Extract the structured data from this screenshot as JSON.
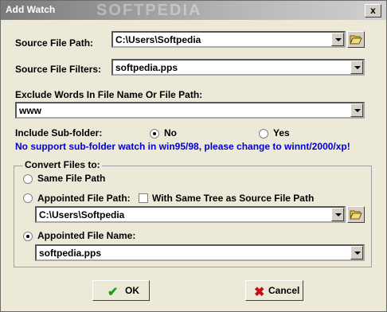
{
  "window": {
    "title": "Add Watch",
    "watermark": "SOFTPEDIA",
    "close_label": "x"
  },
  "source_path": {
    "label": "Source File Path:",
    "value": "C:\\Users\\Softpedia"
  },
  "source_filters": {
    "label": "Source File Filters:",
    "value": "softpedia.pps"
  },
  "exclude": {
    "label": "Exclude Words In File Name Or File Path:",
    "value": "www"
  },
  "subfolder": {
    "label": "Include Sub-folder:",
    "no_label": "No",
    "yes_label": "Yes",
    "selected": "No",
    "warning": "No support sub-folder watch in win95/98, please change to winnt/2000/xp!"
  },
  "convert": {
    "group_label": "Convert Files to:",
    "same_label": "Same File Path",
    "appointed_path_label": "Appointed File  Path:",
    "same_tree_label": "With Same Tree as Source File Path",
    "appointed_path_value": "C:\\Users\\Softpedia",
    "appointed_name_label": "Appointed File Name:",
    "appointed_name_value": "softpedia.pps",
    "selected": "Appointed File Name"
  },
  "buttons": {
    "ok": "OK",
    "cancel": "Cancel"
  },
  "colors": {
    "warning_text": "#0000d0",
    "ok_check": "#1aa01a",
    "cancel_x": "#c01010"
  }
}
